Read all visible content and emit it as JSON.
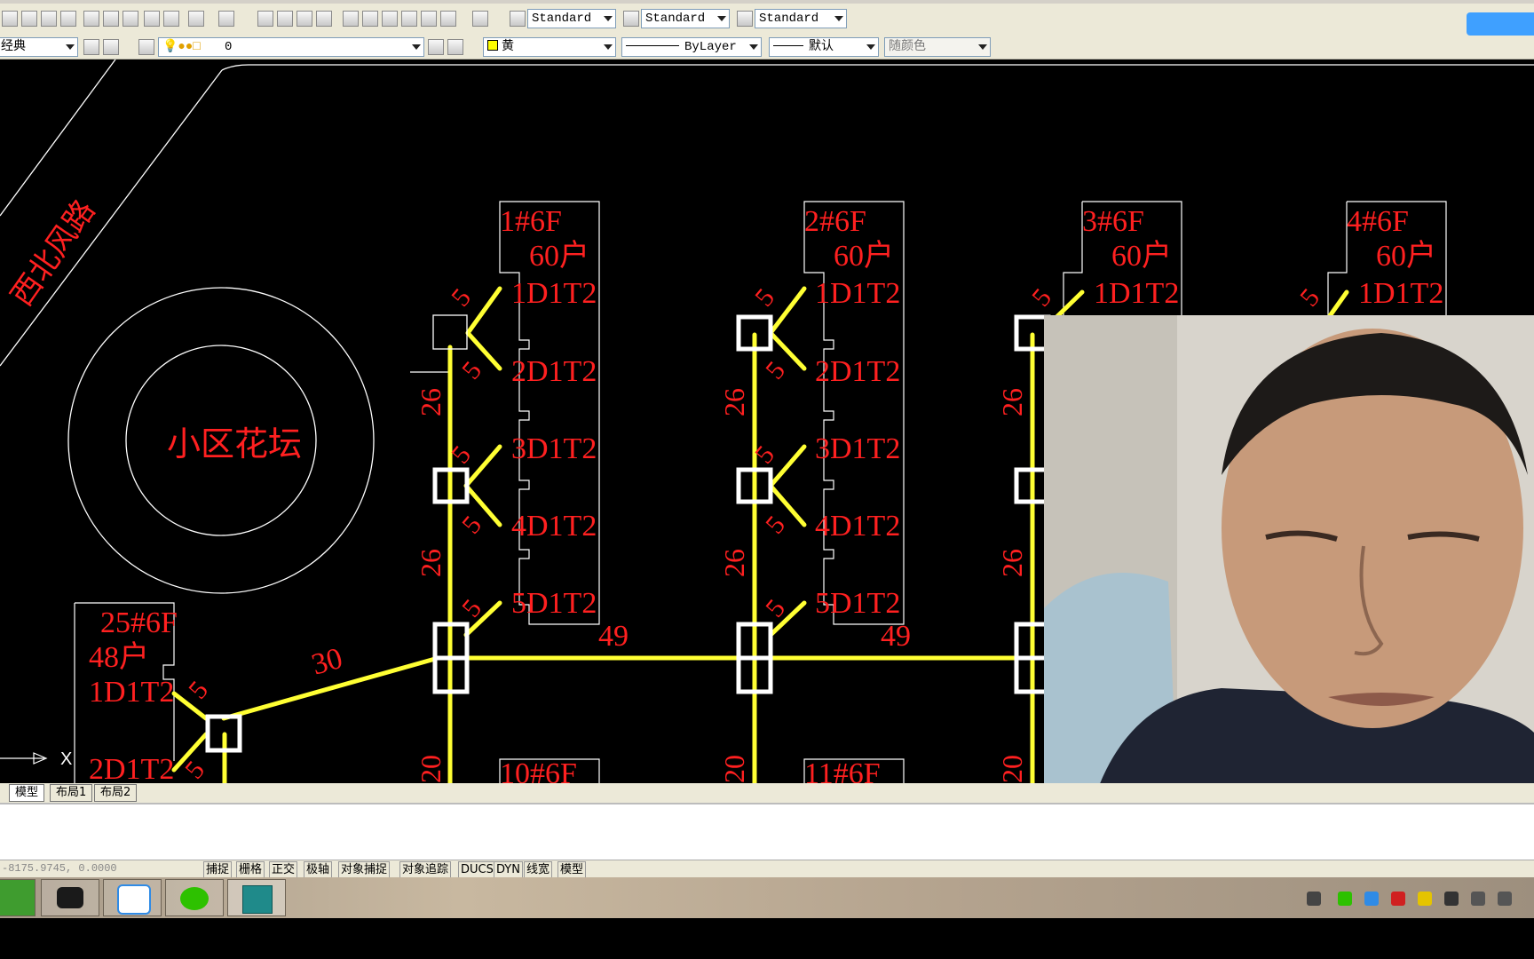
{
  "toolbar1": {
    "text_style": "Standard",
    "dim_style": "Standard",
    "table_style": "Standard"
  },
  "toolbar2": {
    "workspace": "经典",
    "layer": "0",
    "color": "黄",
    "linetype": "ByLayer",
    "lineweight": "默认",
    "plotstyle": "随颜色"
  },
  "drawing": {
    "road_label": "西北风路",
    "garden_label": "小区花坛",
    "buildings": [
      {
        "name": "1#6F",
        "households": "60户",
        "units": [
          "1D1T2",
          "2D1T2",
          "3D1T2",
          "4D1T2",
          "5D1T2"
        ]
      },
      {
        "name": "2#6F",
        "households": "60户",
        "units": [
          "1D1T2",
          "2D1T2",
          "3D1T2",
          "4D1T2",
          "5D1T2"
        ]
      },
      {
        "name": "3#6F",
        "households": "60户",
        "units": [
          "1D1T2"
        ]
      },
      {
        "name": "4#6F",
        "households": "60户",
        "units": [
          "1D1T2"
        ]
      },
      {
        "name": "25#6F",
        "households": "48户",
        "units": [
          "1D1T2",
          "2D1T2"
        ]
      },
      {
        "name": "10#6F"
      },
      {
        "name": "11#6F"
      }
    ],
    "lengths": {
      "branch": "5",
      "riser": "26",
      "trunk": "49",
      "diag": "30",
      "down": "20"
    }
  },
  "tabs": [
    "模型",
    "布局1",
    "布局2"
  ],
  "status": {
    "coords": "-8175.9745, 0.0000",
    "buttons": [
      "捕捉",
      "栅格",
      "正交",
      "极轴",
      "对象捕捉",
      "对象追踪",
      "DUCS",
      "DYN",
      "线宽",
      "模型"
    ]
  },
  "colors": {
    "cad_red": "#ff2020",
    "cad_yellow": "#ffff33",
    "background": "#000000"
  }
}
